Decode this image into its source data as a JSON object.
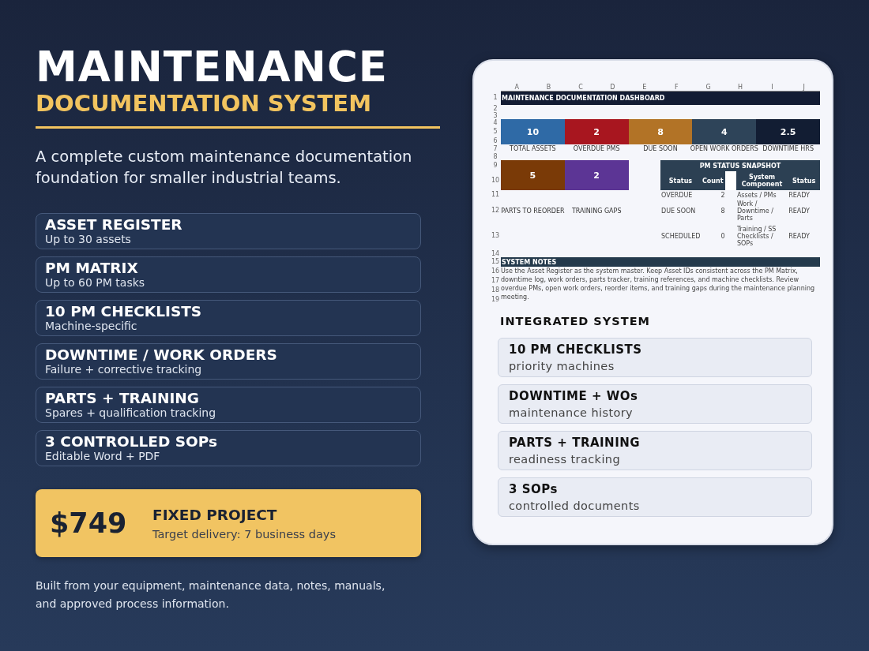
{
  "hero": {
    "title": "MAINTENANCE",
    "subtitle": "DOCUMENTATION SYSTEM",
    "description": "A complete custom maintenance documentation foundation for smaller industrial teams."
  },
  "features": [
    {
      "title": "ASSET REGISTER",
      "subtitle": "Up to 30 assets"
    },
    {
      "title": "PM MATRIX",
      "subtitle": "Up to 60 PM tasks"
    },
    {
      "title": "10 PM CHECKLISTS",
      "subtitle": "Machine-specific"
    },
    {
      "title": "DOWNTIME / WORK ORDERS",
      "subtitle": "Failure + corrective tracking"
    },
    {
      "title": "PARTS + TRAINING",
      "subtitle": "Spares + qualification tracking"
    },
    {
      "title": "3 CONTROLLED SOPs",
      "subtitle": "Editable Word + PDF"
    }
  ],
  "price": {
    "amount": "$749",
    "label": "FIXED PROJECT",
    "note": "Target delivery: 7 business days"
  },
  "footer": "Built from your equipment, maintenance data, notes, manuals, and approved process information.",
  "sheet": {
    "columns": [
      "A",
      "B",
      "C",
      "D",
      "E",
      "F",
      "G",
      "H",
      "I",
      "J"
    ],
    "rows": [
      "1",
      "2",
      "3",
      "4",
      "5",
      "6",
      "7",
      "8",
      "9",
      "10",
      "11",
      "12",
      "13",
      "14",
      "15",
      "16",
      "17",
      "18",
      "19"
    ],
    "title": "MAINTENANCE DOCUMENTATION DASHBOARD",
    "kpis": [
      {
        "value": "10",
        "label": "TOTAL ASSETS",
        "color": "#2f6aa6"
      },
      {
        "value": "2",
        "label": "OVERDUE PMS",
        "color": "#a8161f"
      },
      {
        "value": "8",
        "label": "DUE SOON",
        "color": "#b27326"
      },
      {
        "value": "4",
        "label": "OPEN WORK ORDERS",
        "color": "#2e4459"
      },
      {
        "value": "2.5",
        "label": "DOWNTIME HRS",
        "color": "#121d33"
      }
    ],
    "kpis_secondary": [
      {
        "value": "5",
        "label": "PARTS TO REORDER",
        "color": "#7a3a07"
      },
      {
        "value": "2",
        "label": "TRAINING GAPS",
        "color": "#5c3595"
      }
    ],
    "snapshot": {
      "title": "PM STATUS SNAPSHOT",
      "columns": [
        "Status",
        "Count",
        "System Component",
        "Status"
      ],
      "rows": [
        [
          "OVERDUE",
          "2",
          "Assets / PMs",
          "READY"
        ],
        [
          "DUE SOON",
          "8",
          "Work / Downtime / Parts",
          "READY"
        ],
        [
          "SCHEDULED",
          "0",
          "Training / SS Checklists / SOPs",
          "READY"
        ]
      ]
    },
    "notes_title": "SYSTEM NOTES",
    "notes": "Use the Asset Register as the system master. Keep Asset IDs consistent across the PM Matrix, downtime log, work orders, parts tracker, training references, and machine checklists. Review overdue PMs, open work orders, reorder items, and training gaps during the maintenance planning meeting."
  },
  "integrated": {
    "heading": "INTEGRATED SYSTEM",
    "items": [
      {
        "title": "10 PM CHECKLISTS",
        "subtitle": "priority machines"
      },
      {
        "title": "DOWNTIME + WOs",
        "subtitle": "maintenance history"
      },
      {
        "title": "PARTS + TRAINING",
        "subtitle": "readiness tracking"
      },
      {
        "title": "3 SOPs",
        "subtitle": "controlled documents"
      }
    ]
  }
}
